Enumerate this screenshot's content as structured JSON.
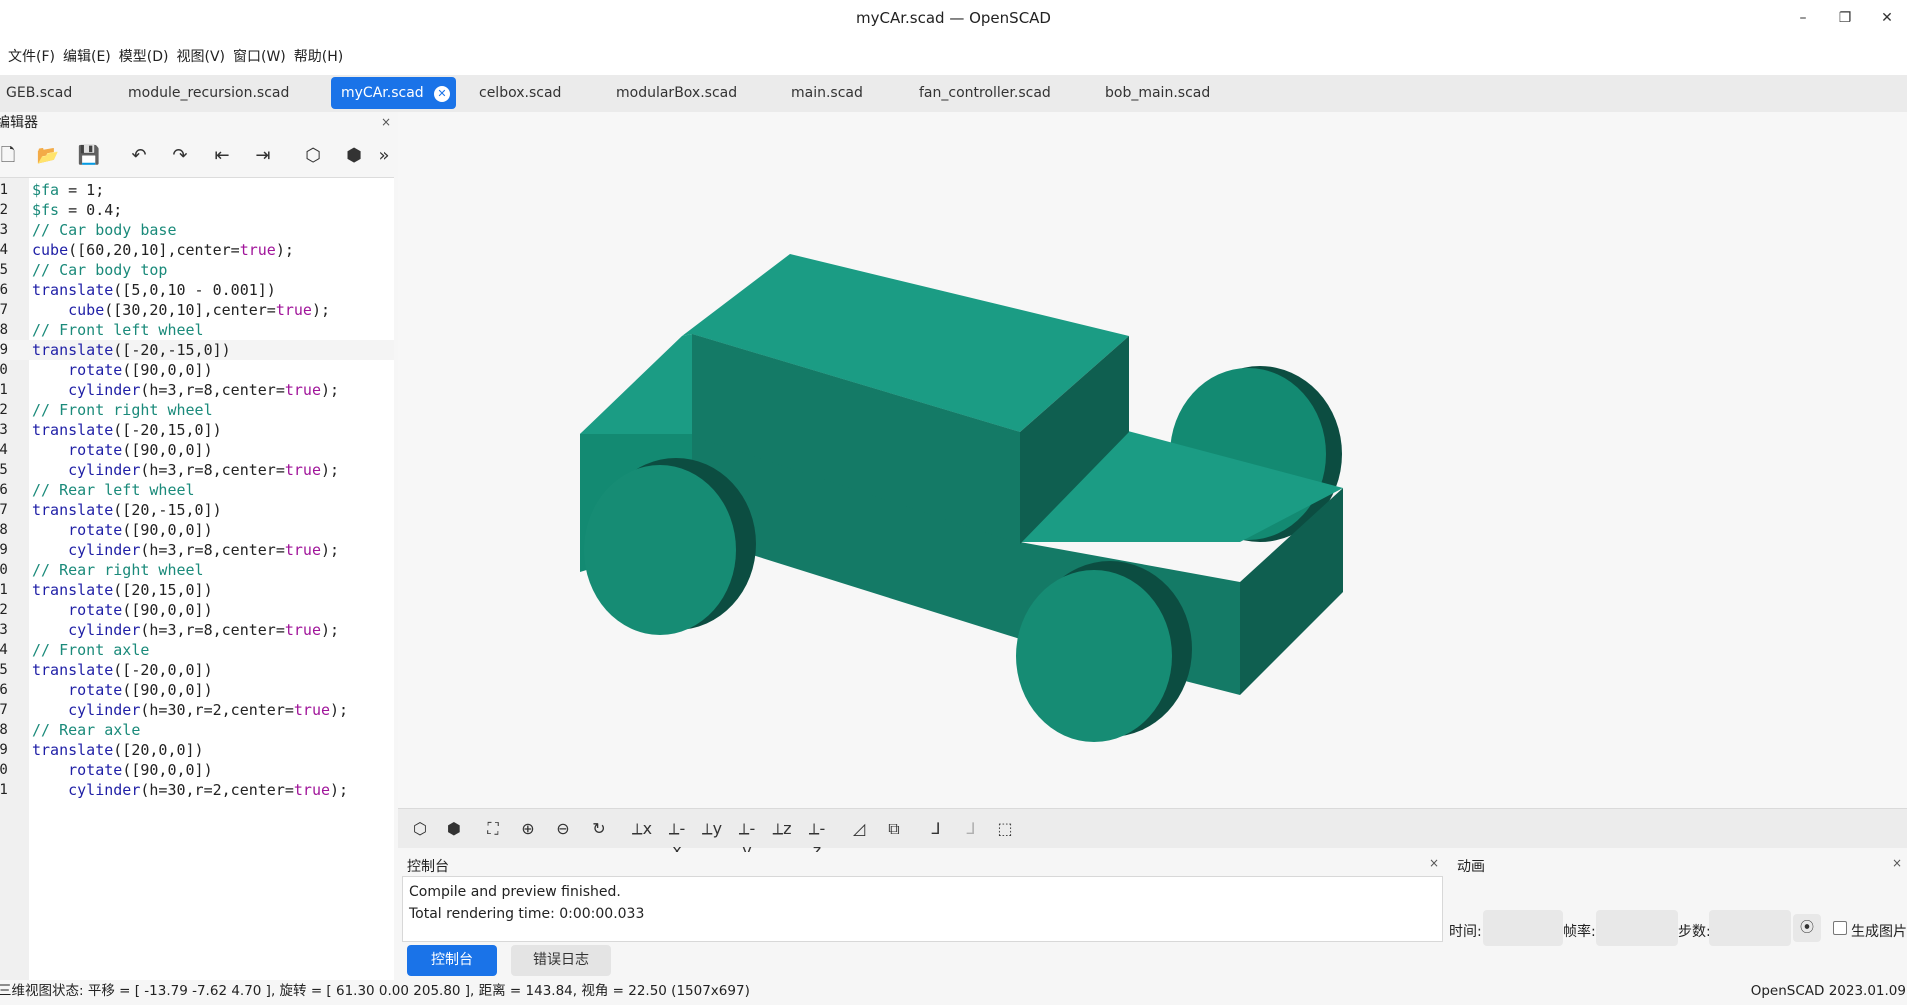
{
  "window": {
    "title": "myCAr.scad — OpenSCAD",
    "minimize_glyph": "–",
    "restore_glyph": "❐",
    "close_glyph": "✕"
  },
  "menubar": {
    "items": [
      {
        "label": "文件(F)"
      },
      {
        "label": "编辑(E)"
      },
      {
        "label": "模型(D)"
      },
      {
        "label": "视图(V)"
      },
      {
        "label": "窗口(W)"
      },
      {
        "label": "帮助(H)"
      }
    ]
  },
  "tabs": [
    {
      "label": "GEB.scad",
      "active": false
    },
    {
      "label": "module_recursion.scad",
      "active": false
    },
    {
      "label": "myCAr.scad",
      "active": true
    },
    {
      "label": "celbox.scad",
      "active": false
    },
    {
      "label": "modularBox.scad",
      "active": false
    },
    {
      "label": "main.scad",
      "active": false
    },
    {
      "label": "fan_controller.scad",
      "active": false
    },
    {
      "label": "bob_main.scad",
      "active": false
    }
  ],
  "editor": {
    "title": "编辑器",
    "close_glyph": "×",
    "toolbar": [
      {
        "icon": "new-file-icon",
        "glyph": "🗋"
      },
      {
        "icon": "open-folder-icon",
        "glyph": "📂"
      },
      {
        "icon": "save-icon",
        "glyph": "💾"
      },
      {
        "icon": "undo-icon",
        "glyph": "↶"
      },
      {
        "icon": "redo-icon",
        "glyph": "↷"
      },
      {
        "icon": "unindent-icon",
        "glyph": "⇤"
      },
      {
        "icon": "indent-icon",
        "glyph": "⇥"
      },
      {
        "icon": "preview-icon",
        "glyph": "⬡"
      },
      {
        "icon": "render-icon",
        "glyph": "⬢"
      },
      {
        "icon": "more-icon",
        "glyph": "»"
      }
    ],
    "lines": [
      "$fa = 1;",
      "$fs = 0.4;",
      "// Car body base",
      "cube([60,20,10],center=true);",
      "// Car body top",
      "translate([5,0,10 - 0.001])",
      "    cube([30,20,10],center=true);",
      "// Front left wheel",
      "translate([-20,-15,0])",
      "    rotate([90,0,0])",
      "    cylinder(h=3,r=8,center=true);",
      "// Front right wheel",
      "translate([-20,15,0])",
      "    rotate([90,0,0])",
      "    cylinder(h=3,r=8,center=true);",
      "// Rear left wheel",
      "translate([20,-15,0])",
      "    rotate([90,0,0])",
      "    cylinder(h=3,r=8,center=true);",
      "// Rear right wheel",
      "translate([20,15,0])",
      "    rotate([90,0,0])",
      "    cylinder(h=3,r=8,center=true);",
      "// Front axle",
      "translate([-20,0,0])",
      "    rotate([90,0,0])",
      "    cylinder(h=30,r=2,center=true);",
      "// Rear axle",
      "translate([20,0,0])",
      "    rotate([90,0,0])",
      "    cylinder(h=30,r=2,center=true);"
    ],
    "current_line": 9
  },
  "viewport": {
    "background": "#f7f7f7",
    "model_colors": {
      "top": "#1b9c84",
      "front": "#147a66",
      "side": "#0f5f50",
      "wheel_face": "#168c74"
    }
  },
  "view_toolbar": [
    {
      "icon": "preview-icon",
      "glyph": "⬡",
      "enabled": true
    },
    {
      "icon": "render-icon",
      "glyph": "⬢",
      "enabled": true
    },
    {
      "icon": "view-all-icon",
      "glyph": "⛶",
      "enabled": true
    },
    {
      "icon": "zoom-in-icon",
      "glyph": "⊕",
      "enabled": true
    },
    {
      "icon": "zoom-out-icon",
      "glyph": "⊖",
      "enabled": true
    },
    {
      "icon": "reset-view-icon",
      "glyph": "↻",
      "enabled": true
    },
    {
      "icon": "view-right-icon",
      "glyph": "⟂x",
      "enabled": true
    },
    {
      "icon": "view-top-icon",
      "glyph": "⟂-x",
      "enabled": true
    },
    {
      "icon": "view-bottom-icon",
      "glyph": "⟂y",
      "enabled": true
    },
    {
      "icon": "view-left-icon",
      "glyph": "⟂-y",
      "enabled": true
    },
    {
      "icon": "view-front-icon",
      "glyph": "⟂z",
      "enabled": true
    },
    {
      "icon": "view-back-icon",
      "glyph": "⟂-z",
      "enabled": true
    },
    {
      "icon": "perspective-icon",
      "glyph": "◿",
      "enabled": true
    },
    {
      "icon": "orthogonal-icon",
      "glyph": "⧉",
      "enabled": true
    },
    {
      "icon": "show-axes-icon",
      "glyph": "⅃",
      "enabled": true
    },
    {
      "icon": "show-scale-icon",
      "glyph": "⅃",
      "enabled": false
    },
    {
      "icon": "show-edges-icon",
      "glyph": "⬚",
      "enabled": true
    }
  ],
  "console": {
    "title": "控制台",
    "close_glyph": "×",
    "messages": [
      "Compile and preview finished.",
      "Total rendering time: 0:00:00.033"
    ],
    "tabs": [
      {
        "label": "控制台",
        "active": true
      },
      {
        "label": "错误日志",
        "active": false
      }
    ]
  },
  "animation": {
    "title": "动画",
    "close_glyph": "×",
    "time_label": "时间:",
    "fps_label": "帧率:",
    "steps_label": "步数:",
    "time_value": "",
    "fps_value": "",
    "steps_value": "",
    "pause_glyph": "⦿",
    "dump_label": "生成图片",
    "dump_checked": false
  },
  "statusbar": {
    "left": "三维视图状态: 平移 = [ -13.79 -7.62 4.70 ], 旋转 = [ 61.30 0.00 205.80 ], 距离 = 143.84, 视角 = 22.50 (1507x697)",
    "right": "OpenSCAD 2023.01.09"
  }
}
